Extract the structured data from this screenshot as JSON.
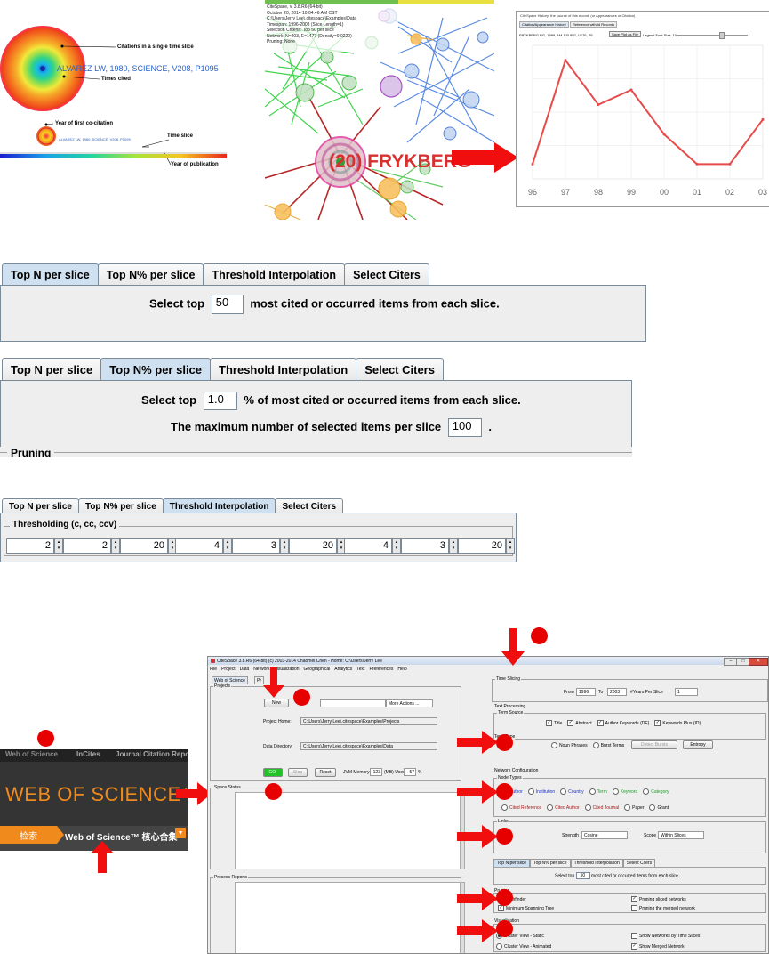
{
  "panel_citation": {
    "node_label": "ALVAREZ LW, 1980, SCIENCE, V208, P1095",
    "small_node_label": "ALVAREZ LW, 1980, SCIENCE, V208, P1095",
    "annot_citations": "Citations in a single time slice",
    "annot_times_cited": "Times cited",
    "annot_first_cocitation": "Year of first co-citation",
    "annot_time_slice": "Time slice",
    "annot_year_pub": "Year of publication"
  },
  "panel_network": {
    "info_lines": [
      "CiteSpace, v. 3.8.R6 (64-bit)",
      "October 20, 2014 10:04:46 AM CST",
      "C:\\Users\\Jerry Lee\\.citespace\\Examples\\Data",
      "Timespan: 1996-2003 (Slice Length=1)",
      "Selection Criteria: Top 50 per slice",
      "Network: N=203, E=1477 (Density=0.0220)",
      "Pruning: None"
    ],
    "node_label": "(20) FRYKBERG"
  },
  "panel_history": {
    "window_title": "CiteSpace History: the source of this record: (or Appearances or Citation)",
    "tabs": [
      "Citation/Appearance History",
      "Reference with Id Records"
    ],
    "record": "FRYKBERG RG, 1998, AM J SURG, V176, P5",
    "save_button": "Save Plot as File",
    "legend_label": "Legend Font Size: 10",
    "chart_data": {
      "type": "line",
      "title": "",
      "xlabel": "",
      "ylabel": "",
      "x": [
        "96",
        "97",
        "98",
        "99",
        "00",
        "01",
        "02",
        "03"
      ],
      "values": [
        1,
        8,
        5,
        6,
        3,
        1,
        1,
        4
      ],
      "ylim": [
        0,
        9
      ],
      "color": "#e84a4a"
    }
  },
  "tabs_a": {
    "tabs": [
      "Top N per slice",
      "Top N% per slice",
      "Threshold Interpolation",
      "Select Citers"
    ],
    "selected": 0,
    "pre": "Select top",
    "value": "50",
    "post": "most cited or occurred items from each slice."
  },
  "tabs_b": {
    "tabs": [
      "Top N per slice",
      "Top N% per slice",
      "Threshold Interpolation",
      "Select Citers"
    ],
    "selected": 1,
    "pre": "Select top",
    "value": "1.0",
    "post": "% of most cited or occurred items from each slice.",
    "max_pre": "The maximum number of selected items per slice",
    "max_value": "100",
    "max_post": ".",
    "pruning": "Pruning"
  },
  "tabs_c": {
    "tabs": [
      "Top N per slice",
      "Top N% per slice",
      "Threshold Interpolation",
      "Select Citers"
    ],
    "selected": 2,
    "group_title": "Thresholding (c, cc, ccv)",
    "spinner_values": [
      "2",
      "2",
      "20",
      "4",
      "3",
      "20",
      "4",
      "3",
      "20"
    ]
  },
  "wos": {
    "top_items": [
      "Web of Science",
      "InCites",
      "Journal Citation Reports"
    ],
    "title": "WEB OF SCIENCE™",
    "search_label": "检索",
    "collection_label": "Web of Science™ 核心合集",
    "dropdown_arrow": "▼"
  },
  "citespace": {
    "title": "CiteSpace 3.8.R6 (64-bit) (c) 2003-2014 Chaomei Chen - Home: C:\\Users\\Jerry Lee",
    "menu": [
      "File",
      "Project",
      "Data",
      "Network",
      "Visualization",
      "Geographical",
      "Analytics",
      "Text",
      "Preferences",
      "Help"
    ],
    "left_tabs": [
      "Web of Science",
      "Pr"
    ],
    "projects_label": "Projects",
    "new_button": "New",
    "more_actions": "More Actions ...",
    "project_home_label": "Project Home:",
    "project_home_value": "C:\\Users\\Jerry Lee\\.citespace\\Examples\\Projects",
    "data_dir_label": "Data Directory:",
    "data_dir_value": "C:\\Users\\Jerry Lee\\.citespace\\Examples\\Data",
    "go_button": "GO!",
    "stop_button": "Stop",
    "reset_button": "Reset",
    "jvm_label": "JVM Memory",
    "jvm_value": "123",
    "jvm_used": "(MB) Used",
    "jvm_pct": "57",
    "jvm_pct_sign": "%",
    "space_status": "Space Status",
    "process_reports": "Process Reports",
    "time_slicing": "Time Slicing",
    "from_label": "From",
    "from_value": "1996",
    "to_label": "To",
    "to_value": "2003",
    "years_label": "#Years Per Slice",
    "years_value": "1",
    "text_processing": "Text Processing",
    "term_source": "Term Source",
    "term_sources": [
      "Title",
      "Abstract",
      "Author Keywords (DE)",
      "Keywords Plus (ID)"
    ],
    "term_type": "Term Type",
    "term_types": [
      "Noun Phrases",
      "Burst Terms"
    ],
    "detect_bursts": "Detect Bursts",
    "entropy": "Entropy",
    "network_config": "Network Configuration",
    "node_types": "Node Types",
    "node_row1": [
      "Author",
      "Institution",
      "Country",
      "Term",
      "Keyword",
      "Category"
    ],
    "node_row2": [
      "Cited Reference",
      "Cited Author",
      "Cited Journal",
      "Paper",
      "Grant"
    ],
    "links": "Links",
    "strength_label": "Strength",
    "strength_value": "Cosine",
    "scope_label": "Scope",
    "scope_value": "Within Slices",
    "sel_tabs": [
      "Top N per slice",
      "Top N% per slice",
      "Threshold Interpolation",
      "Select Citers"
    ],
    "sel_pre": "Select top",
    "sel_value": "50",
    "sel_post": "most cited or occurred items from each slice.",
    "pruning": "Pruning",
    "pruning_items": [
      "Pathfinder",
      "Pruning sliced networks",
      "Minimum Spanning Tree",
      "Pruning the merged network"
    ],
    "visualization": "Visualization",
    "vis_items": [
      "Cluster View - Static",
      "Show Networks by Time Slices",
      "Cluster View - Animated",
      "Show Merged Network"
    ]
  }
}
